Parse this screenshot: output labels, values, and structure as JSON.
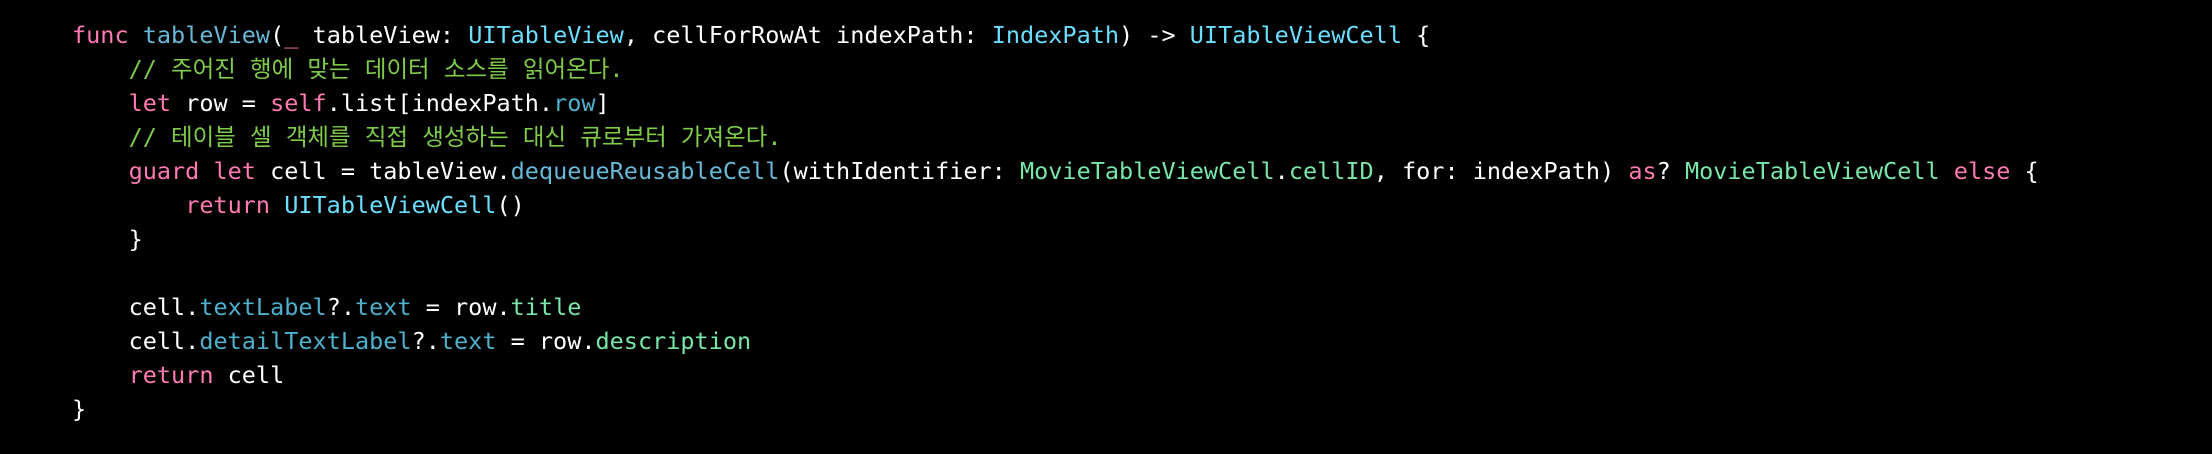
{
  "colors": {
    "background": "#000000",
    "keyword": "#ff7ab2",
    "function": "#67b7d6",
    "type": "#6bdfff",
    "class_name": "#79e6a9",
    "property": "#4eb0cc",
    "comment": "#7ecb4a",
    "plain": "#ffffff"
  },
  "code": {
    "lines": [
      {
        "tokens": [
          {
            "t": "func",
            "k": "kw"
          },
          {
            "t": " ",
            "k": "plain"
          },
          {
            "t": "tableView",
            "k": "fn"
          },
          {
            "t": "(",
            "k": "plain"
          },
          {
            "t": "_",
            "k": "kw"
          },
          {
            "t": " tableView: ",
            "k": "plain"
          },
          {
            "t": "UITableView",
            "k": "type"
          },
          {
            "t": ", cellForRowAt indexPath: ",
            "k": "plain"
          },
          {
            "t": "IndexPath",
            "k": "type"
          },
          {
            "t": ") -> ",
            "k": "plain"
          },
          {
            "t": "UITableViewCell",
            "k": "type"
          },
          {
            "t": " {",
            "k": "plain"
          }
        ]
      },
      {
        "tokens": [
          {
            "t": "    // 주어진 행에 맞는 데이터 소스를 읽어온다.",
            "k": "cmt"
          }
        ]
      },
      {
        "tokens": [
          {
            "t": "    ",
            "k": "plain"
          },
          {
            "t": "let",
            "k": "kw"
          },
          {
            "t": " row = ",
            "k": "plain"
          },
          {
            "t": "self",
            "k": "kw"
          },
          {
            "t": ".list[indexPath.",
            "k": "plain"
          },
          {
            "t": "row",
            "k": "prop"
          },
          {
            "t": "]",
            "k": "plain"
          }
        ]
      },
      {
        "tokens": [
          {
            "t": "    // 테이블 셀 객체를 직접 생성하는 대신 큐로부터 가져온다.",
            "k": "cmt"
          }
        ]
      },
      {
        "tokens": [
          {
            "t": "    ",
            "k": "plain"
          },
          {
            "t": "guard",
            "k": "kw"
          },
          {
            "t": " ",
            "k": "plain"
          },
          {
            "t": "let",
            "k": "kw"
          },
          {
            "t": " cell = tableView.",
            "k": "plain"
          },
          {
            "t": "dequeueReusableCell",
            "k": "fn"
          },
          {
            "t": "(withIdentifier: ",
            "k": "plain"
          },
          {
            "t": "MovieTableViewCell",
            "k": "cls"
          },
          {
            "t": ".",
            "k": "plain"
          },
          {
            "t": "cellID",
            "k": "cls"
          },
          {
            "t": ", for: indexPath) ",
            "k": "plain"
          },
          {
            "t": "as",
            "k": "kw"
          },
          {
            "t": "? ",
            "k": "plain"
          },
          {
            "t": "MovieTableViewCell",
            "k": "cls"
          },
          {
            "t": " ",
            "k": "plain"
          },
          {
            "t": "else",
            "k": "kw"
          },
          {
            "t": " {",
            "k": "plain"
          }
        ]
      },
      {
        "tokens": [
          {
            "t": "        ",
            "k": "plain"
          },
          {
            "t": "return",
            "k": "kw"
          },
          {
            "t": " ",
            "k": "plain"
          },
          {
            "t": "UITableViewCell",
            "k": "type"
          },
          {
            "t": "()",
            "k": "plain"
          }
        ]
      },
      {
        "tokens": [
          {
            "t": "    }",
            "k": "plain"
          }
        ]
      },
      {
        "tokens": []
      },
      {
        "tokens": [
          {
            "t": "    cell.",
            "k": "plain"
          },
          {
            "t": "textLabel",
            "k": "prop"
          },
          {
            "t": "?.",
            "k": "plain"
          },
          {
            "t": "text",
            "k": "prop"
          },
          {
            "t": " = row.",
            "k": "plain"
          },
          {
            "t": "title",
            "k": "cls"
          }
        ]
      },
      {
        "tokens": [
          {
            "t": "    cell.",
            "k": "plain"
          },
          {
            "t": "detailTextLabel",
            "k": "prop"
          },
          {
            "t": "?.",
            "k": "plain"
          },
          {
            "t": "text",
            "k": "prop"
          },
          {
            "t": " = row.",
            "k": "plain"
          },
          {
            "t": "description",
            "k": "cls"
          }
        ]
      },
      {
        "tokens": [
          {
            "t": "    ",
            "k": "plain"
          },
          {
            "t": "return",
            "k": "kw"
          },
          {
            "t": " cell",
            "k": "plain"
          }
        ]
      },
      {
        "tokens": [
          {
            "t": "}",
            "k": "plain"
          }
        ]
      }
    ]
  }
}
